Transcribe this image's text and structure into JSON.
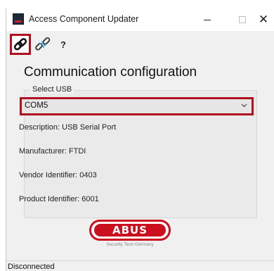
{
  "window": {
    "title": "Access Component Updater",
    "controls": {
      "minimize": "minimize",
      "maximize": "maximize",
      "close": "✕"
    }
  },
  "toolbar": {
    "connect_icon": "link-icon",
    "disconnect_icon": "broken-link-icon",
    "help_label": "?"
  },
  "main": {
    "heading": "Communication configuration",
    "usb_group": {
      "legend": "Select USB",
      "selected_port": "COM5",
      "description": "Description: USB Serial Port",
      "manufacturer": "Manufacturer: FTDI",
      "vendor_id": "Vendor Identifier: 0403",
      "product_id": "Product Identifier: 6001"
    }
  },
  "logo": {
    "brand": "ABUS",
    "tagline": "Security Tech Germany"
  },
  "status": {
    "text": "Disconnected"
  },
  "colors": {
    "highlight": "#b01020",
    "brand_red": "#cc0f1f",
    "window_bg": "#f0f0f0"
  }
}
